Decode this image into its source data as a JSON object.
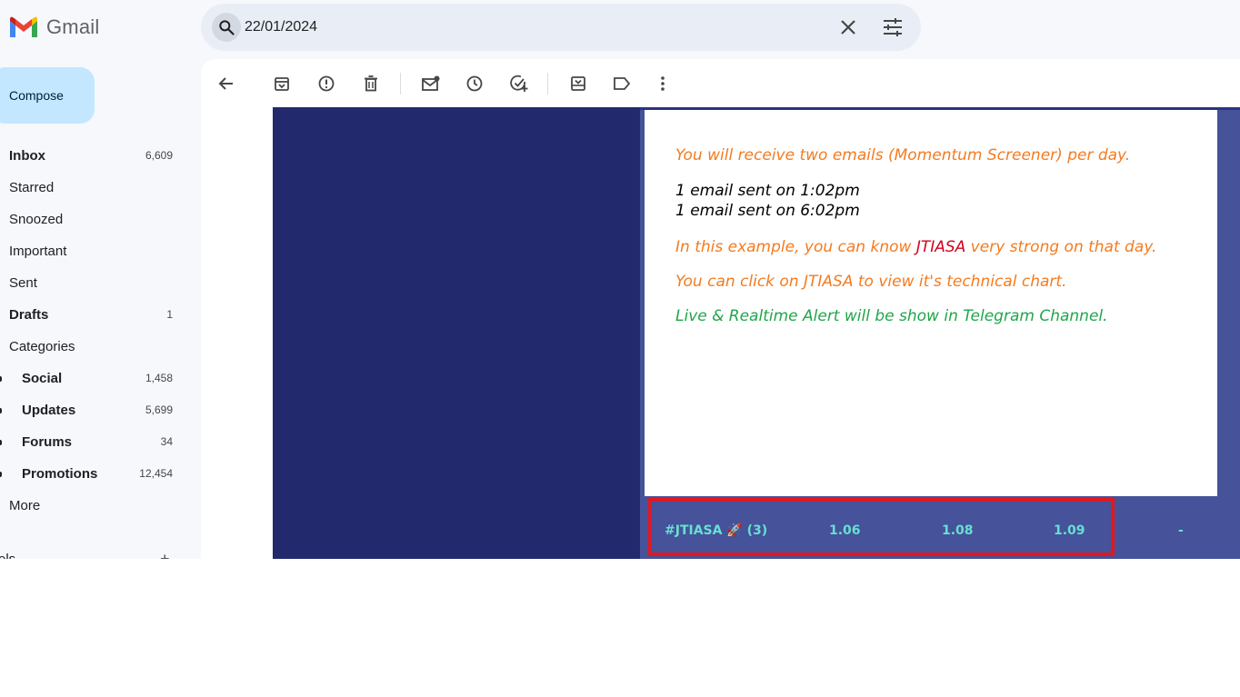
{
  "app": {
    "name": "Gmail"
  },
  "search": {
    "value": "22/01/2024"
  },
  "compose": {
    "label": "Compose"
  },
  "nav": [
    {
      "label": "Inbox",
      "count": "6,609",
      "bold": true
    },
    {
      "label": "Starred",
      "count": ""
    },
    {
      "label": "Snoozed",
      "count": ""
    },
    {
      "label": "Important",
      "count": ""
    },
    {
      "label": "Sent",
      "count": ""
    },
    {
      "label": "Drafts",
      "count": "1",
      "bold": true
    },
    {
      "label": "Categories",
      "count": ""
    },
    {
      "label": "Social",
      "count": "1,458",
      "sub": true
    },
    {
      "label": "Updates",
      "count": "5,699",
      "sub": true
    },
    {
      "label": "Forums",
      "count": "34",
      "sub": true
    },
    {
      "label": "Promotions",
      "count": "12,454",
      "sub": true
    },
    {
      "label": "More",
      "count": ""
    }
  ],
  "labels_header": {
    "label": "els",
    "add": "+"
  },
  "email": {
    "line1": "You will receive two emails (Momentum Screener) per day.",
    "line2": "1 email sent on 1:02pm",
    "line3": "1 email sent on 6:02pm",
    "line4_pre": "In this example, you can know ",
    "line4_highlight": "JTIASA",
    "line4_post": " very strong on that day.",
    "line5": "You can click on JTIASA to view it's technical chart.",
    "line6": "Live & Realtime Alert will be show in Telegram Channel.",
    "row": {
      "ticker": "#JTIASA 🚀 (3)",
      "v1": "1.06",
      "v2": "1.08",
      "v3": "1.09",
      "v4": "-"
    }
  },
  "colors": {
    "accent_compose": "#c2e7ff",
    "email_dark": "#222a6d",
    "email_table": "#46529a",
    "highlight_box": "#e0181f",
    "text_orange": "#f47b20",
    "text_green": "#1fa64a",
    "text_red": "#d0021b",
    "row_text": "#66e0d2"
  }
}
